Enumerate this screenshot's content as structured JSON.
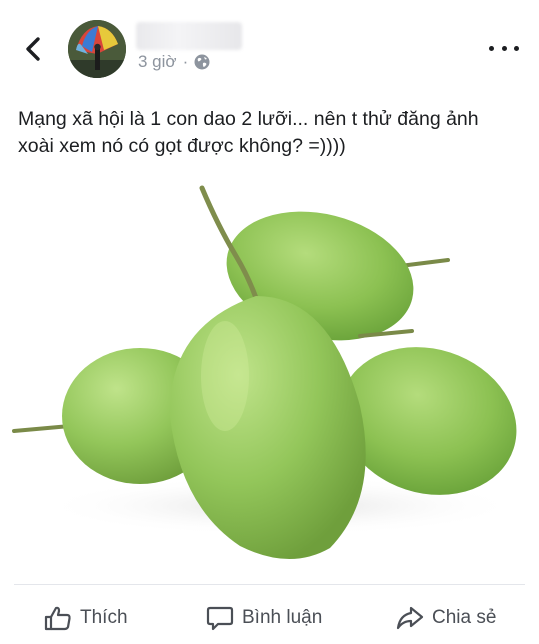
{
  "post": {
    "time": "3 giờ",
    "separator": "·",
    "text_line1": "Mạng xã hội là 1 con dao 2 lưỡi... nên t thử đăng ảnh",
    "text_line2": "xoài xem nó có gọt được không?  =))))"
  },
  "actions": {
    "like_label": "Thích",
    "comment_label": "Bình luận",
    "share_label": "Chia sẻ"
  },
  "icons": {
    "back": "chevron-left-icon",
    "privacy": "globe-icon",
    "more": "more-horizontal-icon",
    "like": "thumbs-up-icon",
    "comment": "comment-bubble-icon",
    "share": "share-arrow-icon"
  },
  "colors": {
    "meta_text": "#8d949e",
    "action_text": "#4b4f56",
    "mango_green": "#8fc257"
  }
}
